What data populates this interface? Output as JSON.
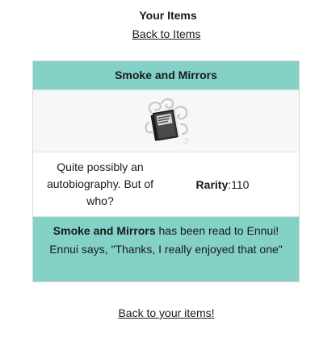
{
  "header": {
    "title": "Your Items",
    "back_link": "Back to Items"
  },
  "item": {
    "name": "Smoke and Mirrors",
    "image_icon": "smoke-book-icon",
    "description": "Quite possibly an autobiography. But of who?",
    "rarity_label": "Rarity",
    "rarity_sep": ": ",
    "rarity_value": "110"
  },
  "result": {
    "item_name": "Smoke and Mirrors",
    "read_text": " has been read to Ennui! Ennui says, \"Thanks, I really enjoyed that one\""
  },
  "footer": {
    "back_link": "Back to your items!"
  },
  "colors": {
    "accent": "#84d1c7",
    "image_row_bg": "#f7f7f7"
  }
}
